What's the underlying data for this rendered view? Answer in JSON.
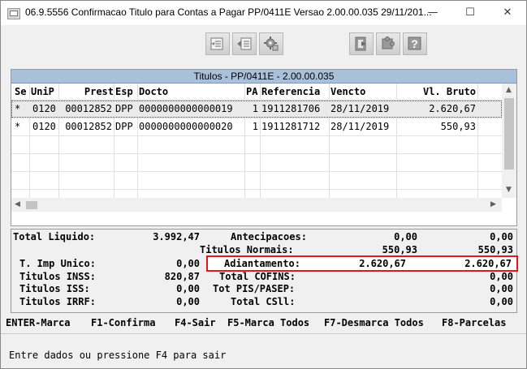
{
  "window": {
    "title": "06.9.5556  Confirmacao Titulo para Contas a Pagar PP/0411E Versao 2.00.00.035 29/11/201...",
    "controls": {
      "minimize": "—",
      "maximize": "☐",
      "close": "✕"
    }
  },
  "toolbar": {
    "buttons": [
      {
        "icon": "list-check-icon"
      },
      {
        "icon": "list-arrow-icon"
      },
      {
        "icon": "gear-config-icon"
      },
      {
        "icon": "exit-door-icon"
      },
      {
        "icon": "puzzle-icon"
      },
      {
        "icon": "help-question-icon"
      }
    ]
  },
  "grid": {
    "title": "Titulos - PP/0411E - 2.00.00.035",
    "headers": {
      "se": "Se",
      "unip": "UniP",
      "prest": "Prest",
      "esp": "Esp",
      "docto": "Docto",
      "pa": "PA",
      "referencia": "Referencia",
      "vencto": "Vencto",
      "vl_bruto": "Vl. Bruto"
    },
    "rows": [
      {
        "se": "*",
        "unip": "0120",
        "prest": "00012852",
        "esp": "DPP",
        "docto": "0000000000000019",
        "pa": "1",
        "referencia": "1911281706",
        "vencto": "28/11/2019",
        "vl_bruto": "2.620,67"
      },
      {
        "se": "*",
        "unip": "0120",
        "prest": "00012852",
        "esp": "DPP",
        "docto": "0000000000000020",
        "pa": "1",
        "referencia": "1911281712",
        "vencto": "28/11/2019",
        "vl_bruto": "550,93"
      }
    ]
  },
  "totals": {
    "total_liquido": {
      "label": "Total Liquido:",
      "value": "3.992,47"
    },
    "t_imp_unico": {
      "label": "T. Imp Unico:",
      "value": "0,00"
    },
    "titulos_inss": {
      "label": "Titulos INSS:",
      "value": "820,87"
    },
    "titulos_iss": {
      "label": "Titulos  ISS:",
      "value": "0,00"
    },
    "titulos_irrf": {
      "label": "Titulos IRRF:",
      "value": "0,00"
    },
    "antecipacoes": {
      "label": "Antecipacoes:",
      "value1": "0,00",
      "value2": "0,00"
    },
    "titulos_normais": {
      "label": "Titulos Normais:",
      "value1": "550,93",
      "value2": "550,93"
    },
    "adiantamento": {
      "label": "Adiantamento:",
      "value1": "2.620,67",
      "value2": "2.620,67"
    },
    "total_cofins": {
      "label": "Total COFINS:",
      "value": "0,00"
    },
    "tot_pis_pasep": {
      "label": "Tot PIS/PASEP:",
      "value": "0,00"
    },
    "total_csll": {
      "label": "Total CSll:",
      "value": "0,00"
    }
  },
  "function_keys": {
    "enter": "ENTER-Marca",
    "f1": "F1-Confirma",
    "f4": "F4-Sair",
    "f5": "F5-Marca Todos",
    "f7": "F7-Desmarca Todos",
    "f8": "F8-Parcelas"
  },
  "status": {
    "message": "Entre dados ou pressione F4 para sair"
  },
  "colors": {
    "grid_title_bg": "#a9c0da",
    "highlight_border": "#e8141d"
  }
}
